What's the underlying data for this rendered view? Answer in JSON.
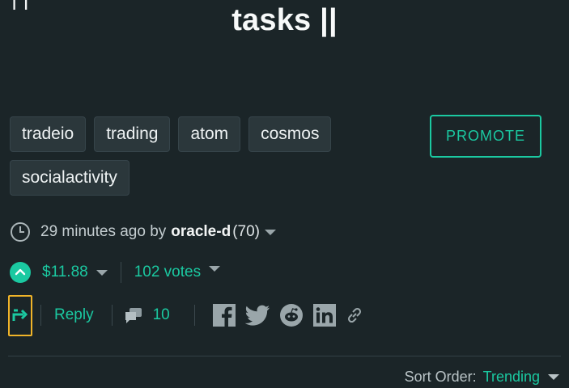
{
  "post": {
    "title": "tasks ||",
    "partial_top_text": "ı ı"
  },
  "tags": [
    "tradeio",
    "trading",
    "atom",
    "cosmos",
    "socialactivity"
  ],
  "promote_label": "PROMOTE",
  "meta": {
    "time_ago": "29 minutes ago by",
    "author": "oracle-d",
    "reputation": "(70)"
  },
  "voting": {
    "payout": "$11.88",
    "votes": "102 votes"
  },
  "actions": {
    "reply_label": "Reply",
    "comment_count": "10"
  },
  "share_icons": [
    "facebook-icon",
    "twitter-icon",
    "reddit-icon",
    "linkedin-icon",
    "link-icon"
  ],
  "sort": {
    "label": "Sort Order:",
    "value": "Trending"
  },
  "colors": {
    "background": "#1b2528",
    "accent": "#1bc9a1",
    "reblog_border": "#f0b429",
    "tag_bg": "#2b373b"
  }
}
